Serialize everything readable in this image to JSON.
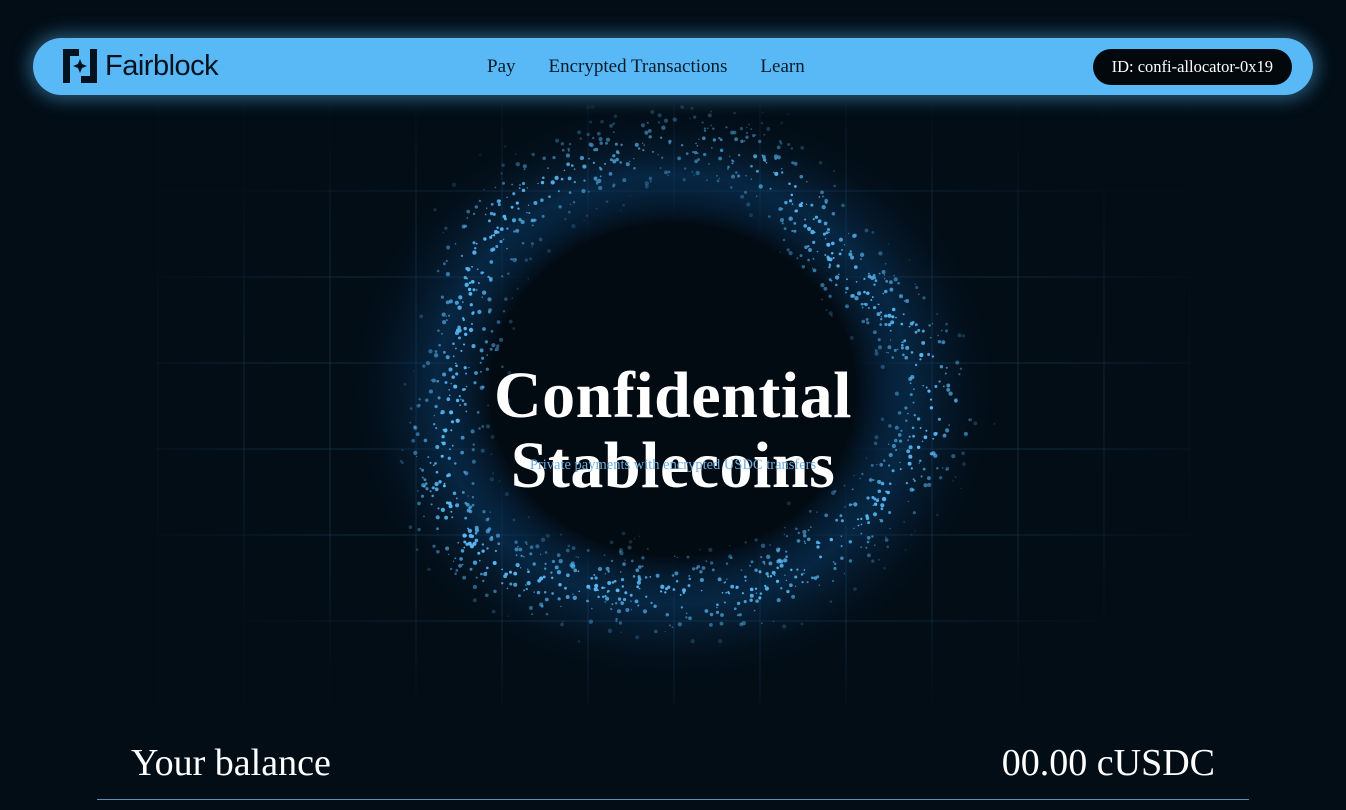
{
  "brand": {
    "name": "Fairblock",
    "accent": "#58b9f6"
  },
  "nav": {
    "links": [
      "Pay",
      "Encrypted Transactions",
      "Learn"
    ]
  },
  "account": {
    "id_label": "ID: confi-allocator-0x19"
  },
  "hero": {
    "title_line1": "Confidential",
    "title_line2": "Stablecoins",
    "subtitle": "Private payments with encrypted USDC transfers"
  },
  "balance": {
    "label": "Your balance",
    "value": "00.00 cUSDC"
  },
  "colors": {
    "background": "#020d16",
    "particle": "#58b9f6",
    "grid": "#1d4463"
  }
}
